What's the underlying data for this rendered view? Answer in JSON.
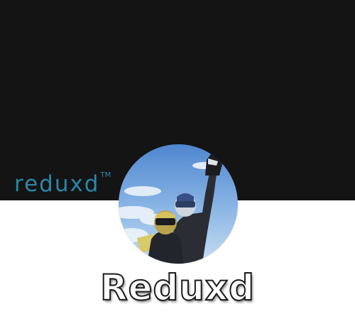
{
  "banner": {
    "logo_text": "reduxd",
    "logo_trademark": "TM",
    "logo_color": "#2b87a8",
    "background_color": "#141414"
  },
  "profile": {
    "avatar_icon": "profile-avatar-image",
    "display_name": "Reduxd"
  }
}
